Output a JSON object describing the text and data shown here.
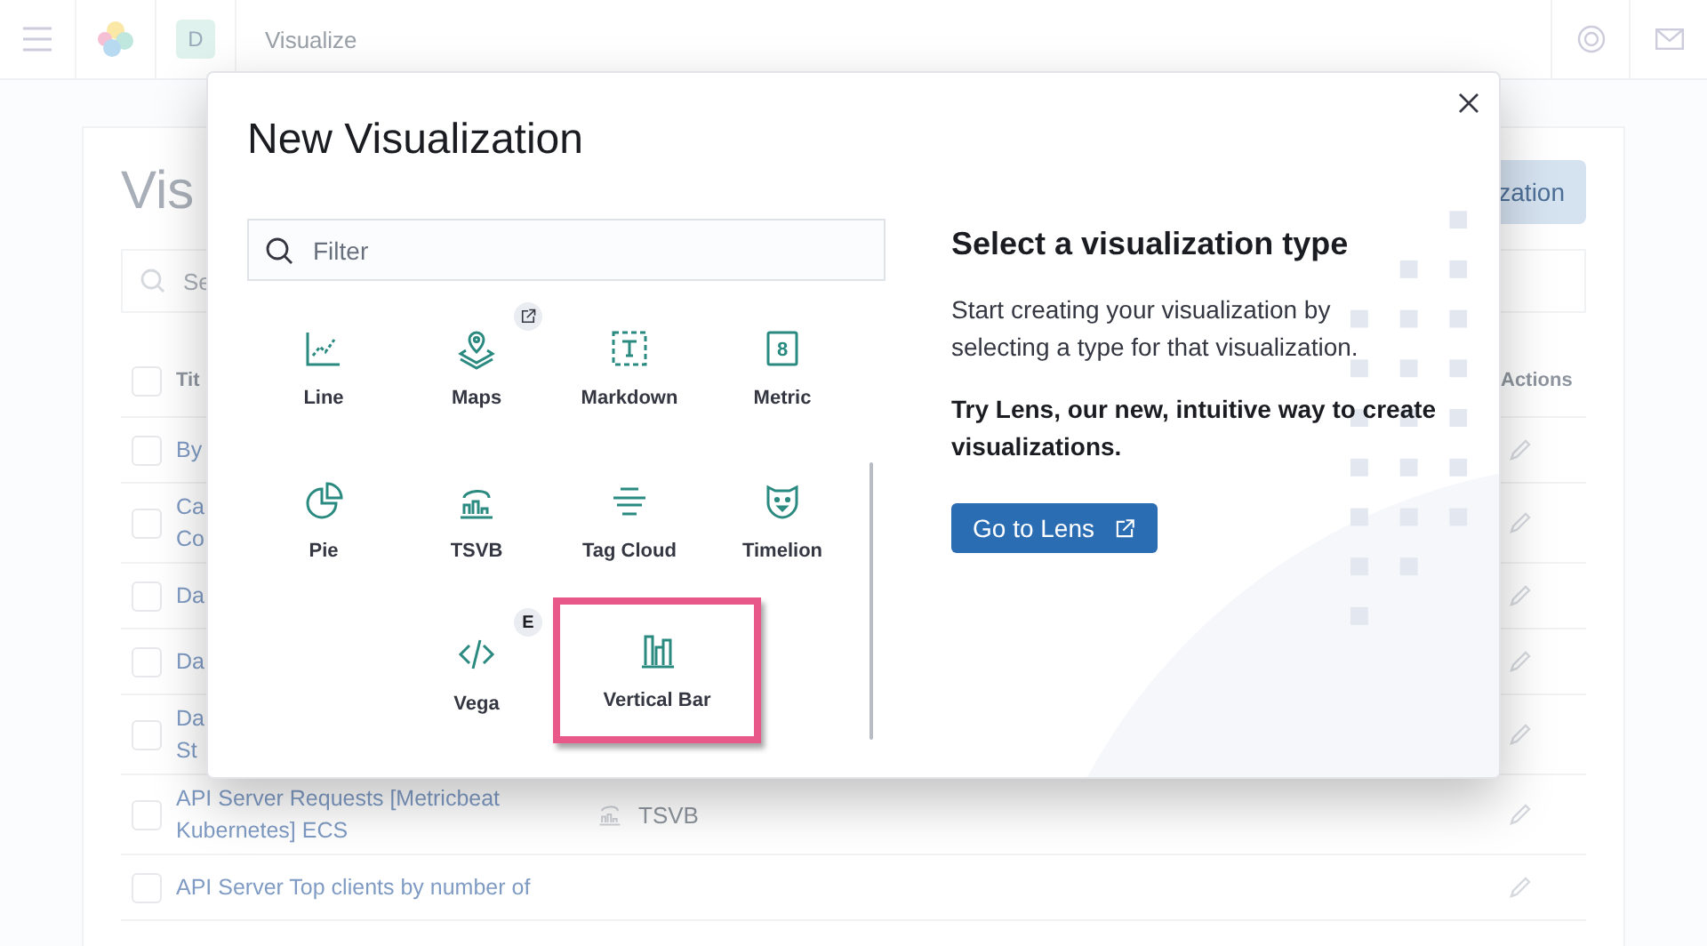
{
  "header": {
    "space_initial": "D",
    "app_title": "Visualize"
  },
  "page": {
    "title": "Vis",
    "create_button": "zation",
    "search_placeholder": "Se",
    "select_all_checked": false,
    "columns": [
      "Tit",
      "Actions"
    ],
    "rows": [
      {
        "title": "By",
        "type": "",
        "checked": false
      },
      {
        "title": "Ca\nCo",
        "type": "",
        "checked": false
      },
      {
        "title": "Da",
        "type": "",
        "checked": false
      },
      {
        "title": "Da",
        "type": "",
        "checked": false
      },
      {
        "title": "Da\nSt",
        "type": "",
        "checked": false
      },
      {
        "title": "API Server Requests [Metricbeat Kubernetes] ECS",
        "type": "TSVB",
        "checked": false
      },
      {
        "title": "API Server Top clients by number of",
        "type": "",
        "checked": false
      }
    ]
  },
  "modal": {
    "title": "New Visualization",
    "filter_placeholder": "Filter",
    "types": [
      {
        "label": "Line",
        "kind": "line",
        "selected": false
      },
      {
        "label": "Maps",
        "kind": "maps",
        "badge": {
          "kind": "external"
        },
        "selected": false
      },
      {
        "label": "Markdown",
        "kind": "markdown",
        "selected": false
      },
      {
        "label": "Metric",
        "kind": "metric",
        "icon_text": "8",
        "selected": false
      },
      {
        "label": "Pie",
        "kind": "pie",
        "selected": false
      },
      {
        "label": "TSVB",
        "kind": "tsvb",
        "selected": false
      },
      {
        "label": "Tag Cloud",
        "kind": "tagcloud",
        "selected": false
      },
      {
        "label": "Timelion",
        "kind": "timelion",
        "selected": false
      },
      {
        "label": "Vega",
        "kind": "vega",
        "badge": {
          "kind": "text",
          "text": "E"
        },
        "selected": false
      },
      {
        "label": "Vertical Bar",
        "kind": "verticalbar",
        "selected": true
      }
    ],
    "heading": "Select a visualization type",
    "description": "Start creating your visualization by selecting a type for that visualization.",
    "promo": "Try Lens, our new, intuitive way to create visualizations.",
    "lens_button": "Go to Lens"
  }
}
